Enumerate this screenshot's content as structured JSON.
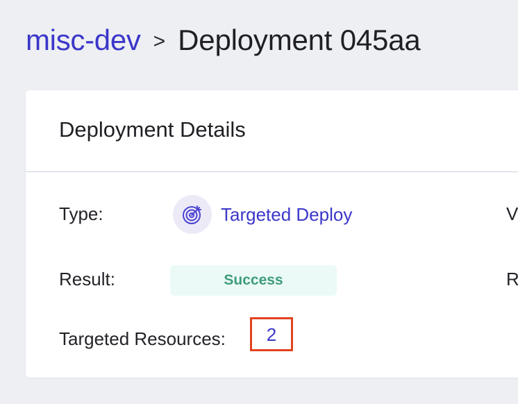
{
  "breadcrumb": {
    "project": "misc-dev",
    "separator": ">",
    "current": "Deployment 045aa"
  },
  "card": {
    "title": "Deployment Details",
    "type": {
      "label": "Type:",
      "icon": "target-icon",
      "value": "Targeted Deploy"
    },
    "result": {
      "label": "Result:",
      "value": "Success",
      "color": "#3f9b7b",
      "background": "#ebfaf6"
    },
    "targeted_resources": {
      "label": "Targeted Resources:",
      "value": "2"
    },
    "right_column": {
      "label_1": "V",
      "label_2": "R"
    }
  },
  "colors": {
    "link": "#3b36c9",
    "highlight_border": "#e2431f",
    "page_background": "#edeff3"
  }
}
